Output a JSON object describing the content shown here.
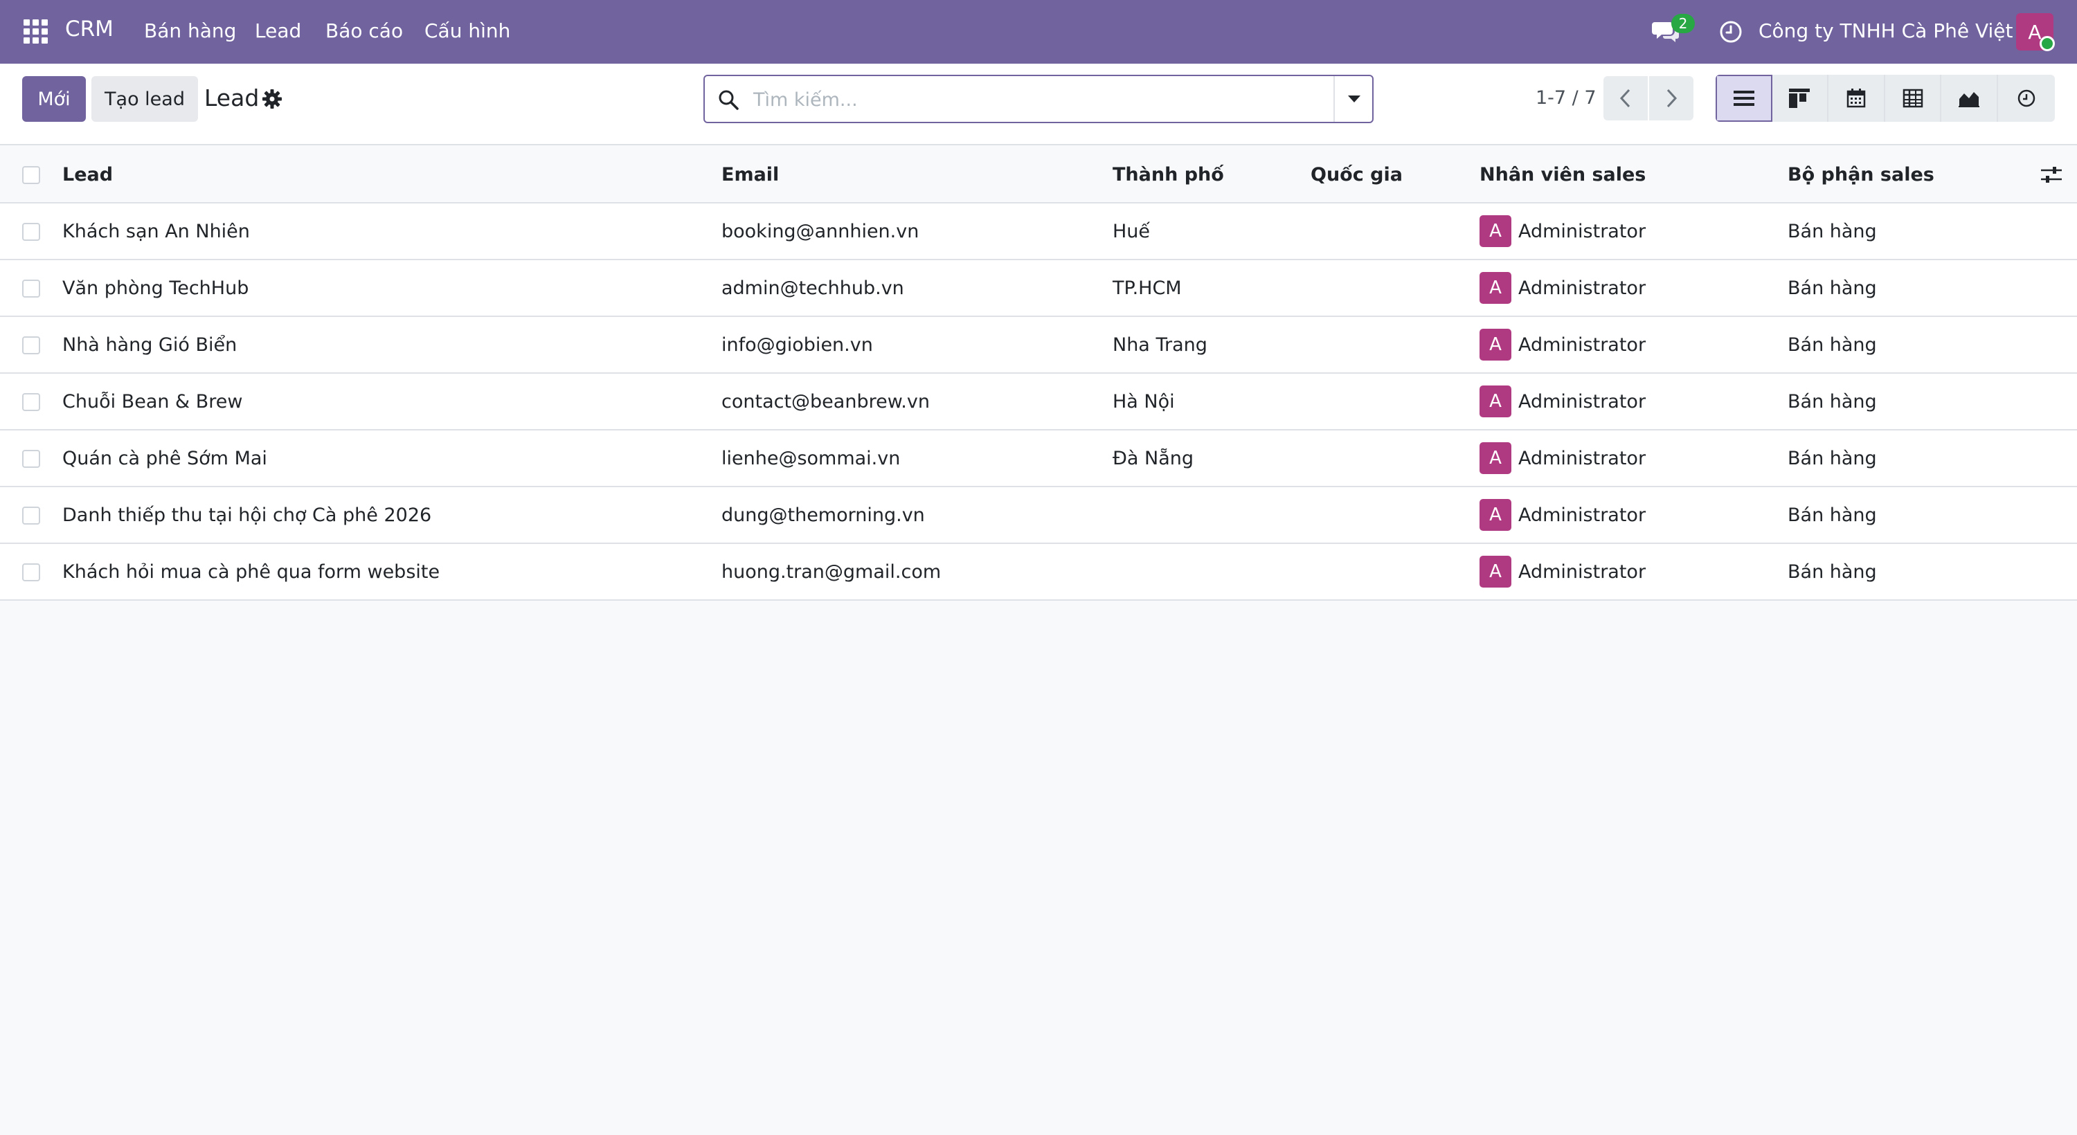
{
  "navbar": {
    "brand": "CRM",
    "menu": [
      "Bán hàng",
      "Lead",
      "Báo cáo",
      "Cấu hình"
    ],
    "chat_count": "2",
    "company": "Công ty TNHH Cà Phê Việt",
    "user_initial": "A",
    "bg_color": "#71639e"
  },
  "control": {
    "new_label": "Mới",
    "create_lead_label": "Tạo lead",
    "breadcrumb": "Lead",
    "search_placeholder": "Tìm kiếm...",
    "pager": "1-7 / 7",
    "views": [
      "list-icon",
      "kanban-icon",
      "calendar-icon",
      "pivot-icon",
      "graph-icon",
      "activity-icon"
    ],
    "active_view": "list-icon"
  },
  "table": {
    "columns": [
      "Lead",
      "Email",
      "Thành phố",
      "Quốc gia",
      "Nhân viên sales",
      "Bộ phận sales"
    ],
    "rows": [
      {
        "lead": "Khách sạn An Nhiên",
        "email": "booking@annhien.vn",
        "city": "Huế",
        "country": "",
        "salesperson": "Administrator",
        "initial": "A",
        "team": "Bán hàng"
      },
      {
        "lead": "Văn phòng TechHub",
        "email": "admin@techhub.vn",
        "city": "TP.HCM",
        "country": "",
        "salesperson": "Administrator",
        "initial": "A",
        "team": "Bán hàng"
      },
      {
        "lead": "Nhà hàng Gió Biển",
        "email": "info@giobien.vn",
        "city": "Nha Trang",
        "country": "",
        "salesperson": "Administrator",
        "initial": "A",
        "team": "Bán hàng"
      },
      {
        "lead": "Chuỗi Bean & Brew",
        "email": "contact@beanbrew.vn",
        "city": "Hà Nội",
        "country": "",
        "salesperson": "Administrator",
        "initial": "A",
        "team": "Bán hàng"
      },
      {
        "lead": "Quán cà phê Sớm Mai",
        "email": "lienhe@sommai.vn",
        "city": "Đà Nẵng",
        "country": "",
        "salesperson": "Administrator",
        "initial": "A",
        "team": "Bán hàng"
      },
      {
        "lead": "Danh thiếp thu tại hội chợ Cà phê 2026",
        "email": "dung@themorning.vn",
        "city": "",
        "country": "",
        "salesperson": "Administrator",
        "initial": "A",
        "team": "Bán hàng"
      },
      {
        "lead": "Khách hỏi mua cà phê qua form website",
        "email": "huong.tran@gmail.com",
        "city": "",
        "country": "",
        "salesperson": "Administrator",
        "initial": "A",
        "team": "Bán hàng"
      }
    ]
  }
}
